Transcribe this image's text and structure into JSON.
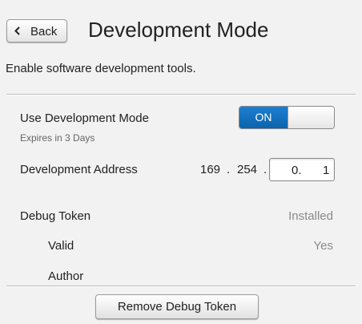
{
  "header": {
    "back_label": "Back",
    "title": "Development Mode"
  },
  "subtitle": "Enable software development tools.",
  "dev_mode": {
    "label": "Use Development Mode",
    "expiry": "Expires in 3 Days",
    "toggle_state": "ON"
  },
  "address": {
    "label": "Development Address",
    "octet1": "169",
    "octet2": "254",
    "editable_octets": "0.",
    "editable_last": "1",
    "separator": "."
  },
  "debug_token": {
    "label": "Debug Token",
    "value": "Installed",
    "valid_label": "Valid",
    "valid_value": "Yes",
    "author_label": "Author",
    "author_value": ""
  },
  "remove_button": "Remove Debug Token",
  "colors": {
    "toggle_on": "#0a64ad",
    "background": "#f2f2f2",
    "secondary_text": "#8a8a8a"
  }
}
